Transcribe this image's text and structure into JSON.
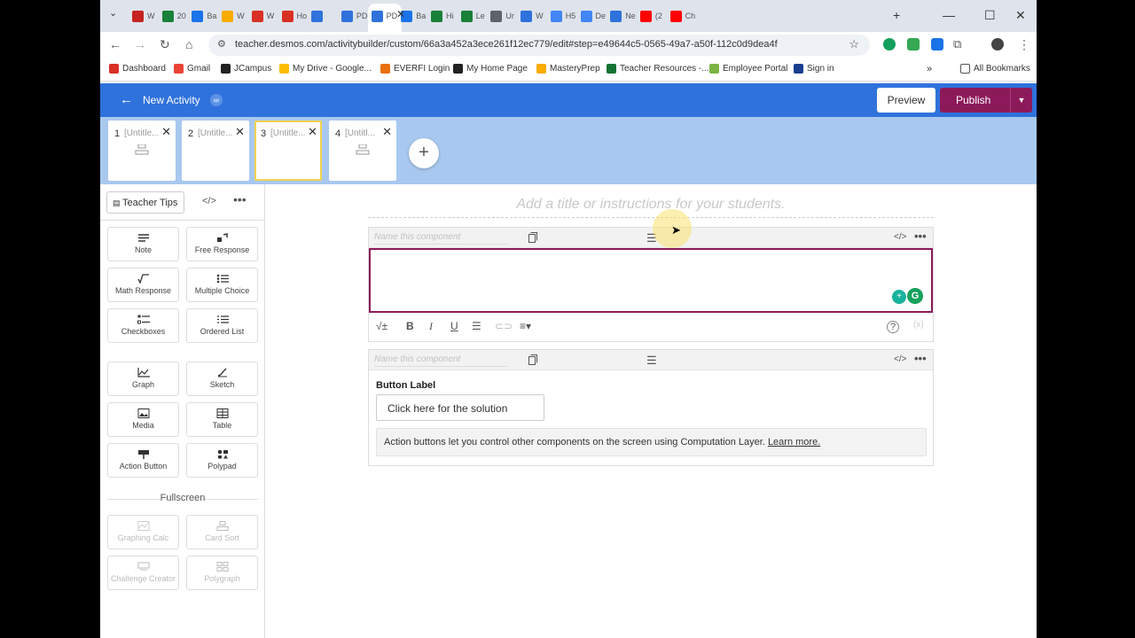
{
  "browser": {
    "tabs": [
      {
        "label": "W",
        "color": "#c5221f"
      },
      {
        "label": "20",
        "color": "#188038"
      },
      {
        "label": "Ba",
        "color": "#1a73e8"
      },
      {
        "label": "W",
        "color": "#f9ab00"
      },
      {
        "label": "W",
        "color": "#d93025"
      },
      {
        "label": "Ho",
        "color": "#d93025"
      },
      {
        "label": "",
        "color": "#2f72dc"
      },
      {
        "label": "PD",
        "color": "#2f72dc"
      },
      {
        "label": "PD",
        "color": "#2f72dc"
      },
      {
        "label": "Ba",
        "color": "#1a73e8"
      },
      {
        "label": "Hi",
        "color": "#188038"
      },
      {
        "label": "Le",
        "color": "#188038"
      },
      {
        "label": "Ur",
        "color": "#5f6368"
      },
      {
        "label": "W",
        "color": "#2f72dc"
      },
      {
        "label": "H5",
        "color": "#4285f4"
      },
      {
        "label": "De",
        "color": "#4285f4"
      },
      {
        "label": "Ne",
        "color": "#2f72dc"
      },
      {
        "label": "(2",
        "color": "#ff0000"
      },
      {
        "label": "Ch",
        "color": "#ff0000"
      }
    ],
    "url": "teacher.desmos.com/activitybuilder/custom/66a3a452a3ece261f12ec779/edit#step=e49644c5-0565-49a7-a50f-112c0d9dea4f",
    "bookmarks": [
      {
        "label": "Dashboard",
        "color": "#d93025"
      },
      {
        "label": "Gmail",
        "color": "#ea4335"
      },
      {
        "label": "JCampus",
        "color": "#222222"
      },
      {
        "label": "My Drive - Google...",
        "color": "#fbbc04"
      },
      {
        "label": "EVERFI Login",
        "color": "#e8710a"
      },
      {
        "label": "My Home Page",
        "color": "#222222"
      },
      {
        "label": "MasteryPrep",
        "color": "#f9ab00"
      },
      {
        "label": "Teacher Resources -...",
        "color": "#137333"
      },
      {
        "label": "Employee Portal",
        "color": "#7cb342"
      },
      {
        "label": "Sign in",
        "color": "#1a3d8f"
      }
    ],
    "all_bookmarks": "All Bookmarks"
  },
  "app": {
    "title": "New Activity",
    "preview": "Preview",
    "publish": "Publish"
  },
  "screens": [
    {
      "num": "1",
      "title": "[Untitle..."
    },
    {
      "num": "2",
      "title": "[Untitle..."
    },
    {
      "num": "3",
      "title": "[Untitle..."
    },
    {
      "num": "4",
      "title": "[Untitl..."
    }
  ],
  "panel": {
    "teacher_tips": "Teacher Tips",
    "components": [
      {
        "label": "Note"
      },
      {
        "label": "Free Response"
      },
      {
        "label": "Math Response"
      },
      {
        "label": "Multiple Choice"
      },
      {
        "label": "Checkboxes"
      },
      {
        "label": "Ordered List"
      },
      {
        "label": "Graph"
      },
      {
        "label": "Sketch"
      },
      {
        "label": "Media"
      },
      {
        "label": "Table"
      },
      {
        "label": "Action Button"
      },
      {
        "label": "Polypad"
      }
    ],
    "fullscreen_heading": "Fullscreen",
    "fullscreen": [
      {
        "label": "Graphing Calc"
      },
      {
        "label": "Card Sort"
      },
      {
        "label": "Challenge Creator"
      },
      {
        "label": "Polygraph"
      }
    ]
  },
  "editor": {
    "instructions_placeholder": "Add a title or instructions for your students.",
    "component_name_placeholder": "Name this component",
    "button_label_heading": "Button Label",
    "button_label_value": "Click here for the solution",
    "action_info": "Action buttons let you control other components on the screen using Computation Layer.",
    "learn_more": "Learn more."
  }
}
